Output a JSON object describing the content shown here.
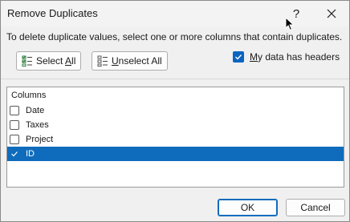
{
  "window": {
    "title": "Remove Duplicates",
    "help_glyph": "?"
  },
  "instruction": "To delete duplicate values, select one or more columns that contain duplicates.",
  "toolbar": {
    "select_all_prefix": "Select ",
    "select_all_accel": "A",
    "select_all_suffix": "ll",
    "unselect_all_accel": "U",
    "unselect_all_suffix": "nselect All"
  },
  "headers_checkbox": {
    "prefix": "",
    "accel": "M",
    "suffix": "y data has headers",
    "checked": true
  },
  "columns": {
    "header": "Columns",
    "items": [
      {
        "label": "Date",
        "checked": false,
        "selected": false
      },
      {
        "label": "Taxes",
        "checked": false,
        "selected": false
      },
      {
        "label": "Project",
        "checked": false,
        "selected": false
      },
      {
        "label": "ID",
        "checked": true,
        "selected": true
      }
    ]
  },
  "footer": {
    "ok_label": "OK",
    "cancel_label": "Cancel"
  },
  "colors": {
    "accent": "#0f6cbd",
    "checkbox_blue": "#0a64c0"
  }
}
